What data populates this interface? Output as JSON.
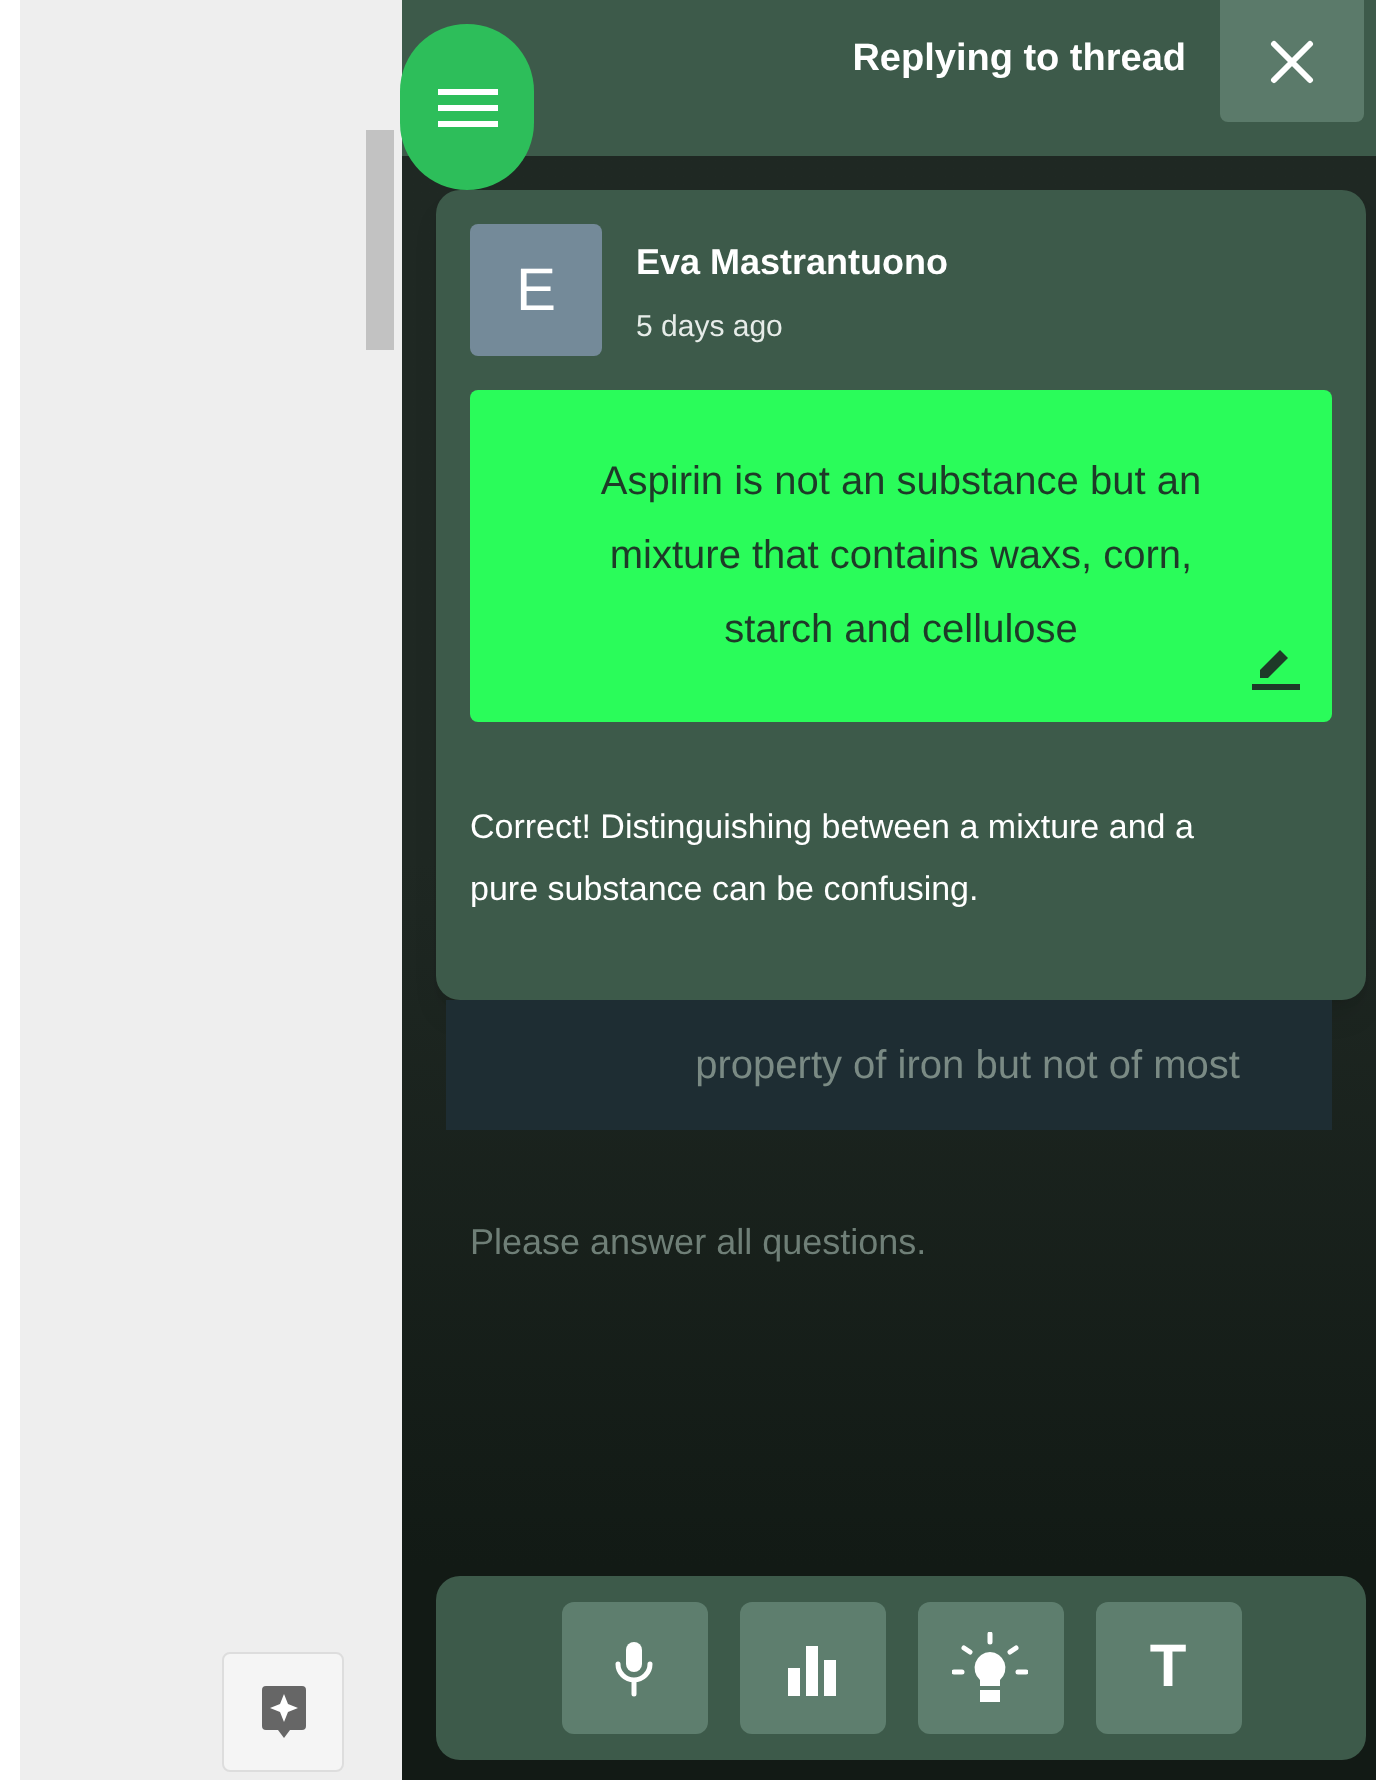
{
  "header": {
    "title": "Replying to thread"
  },
  "comment": {
    "avatar_letter": "E",
    "author": "Eva Mastrantuono",
    "time": "5 days ago",
    "answer": "Aspirin is not an substance but an mixture that contains waxs, corn, starch and cellulose",
    "reply": "Correct! Distinguishing between a mixture and a pure substance can be confusing."
  },
  "background": {
    "answer_fragment": "property of iron but not of most",
    "notice": "Please answer all questions."
  },
  "toolbar": [
    {
      "kind": "microphone"
    },
    {
      "kind": "chart"
    },
    {
      "kind": "idea"
    },
    {
      "kind": "text",
      "label": "T"
    }
  ]
}
